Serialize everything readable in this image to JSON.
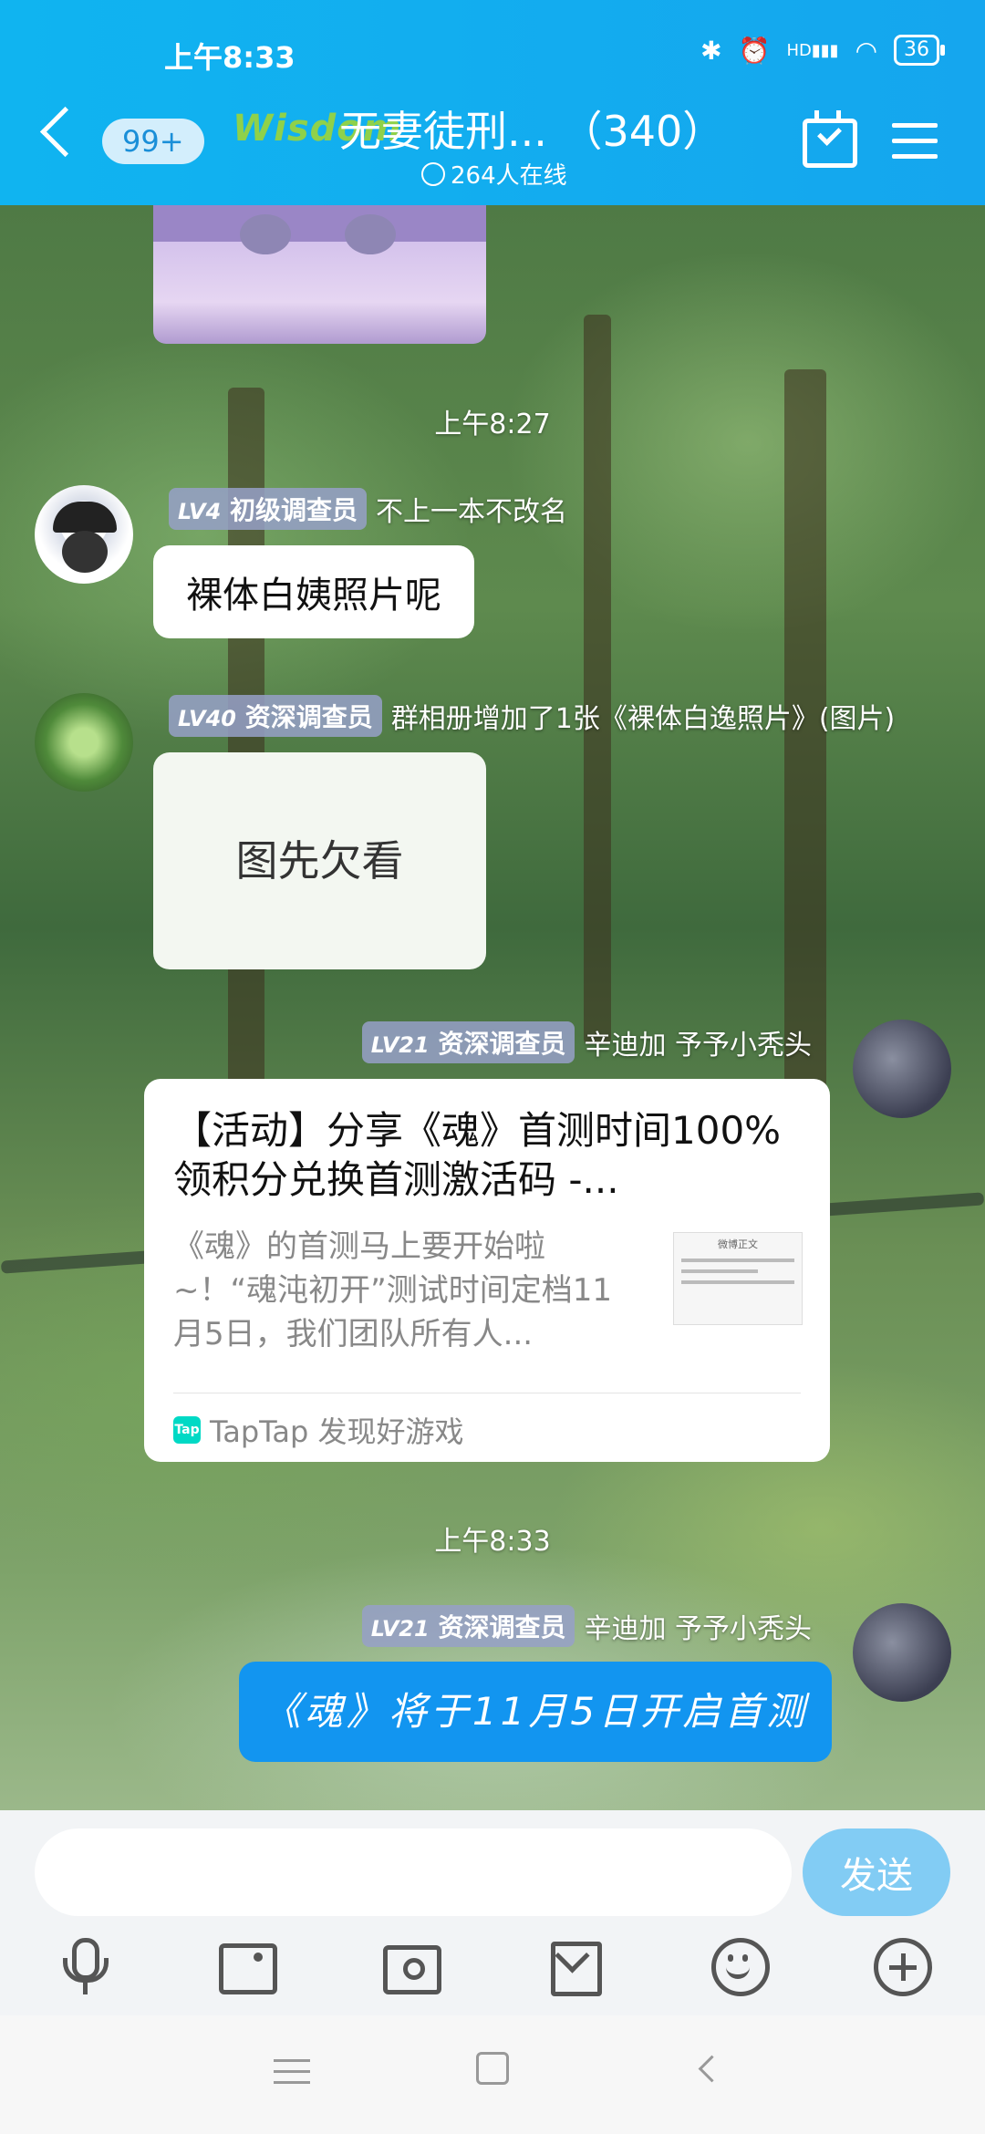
{
  "status_bar": {
    "time": "上午8:33",
    "hd_label": "HD",
    "battery": "36"
  },
  "header": {
    "unread_count": "99+",
    "group_logo": "Wisdom",
    "group_title": "无妻徒刑...  （340）",
    "online_count": "264人在线"
  },
  "messages": [
    {
      "time": "上午8:27"
    },
    {
      "level": "LV4",
      "title": "初级调查员",
      "sender": "不上一本不改名",
      "text": "裸体白姨照片呢"
    },
    {
      "level": "LV40",
      "title": "资深调查员",
      "sender": "群相册增加了1张《裸体白逸照片》(图片)",
      "placeholder_text": "图先欠看"
    },
    {
      "level": "LV21",
      "title": "资深调查员",
      "sender": "辛迪加  予予小秃头",
      "card": {
        "title": "【活动】分享《魂》首测时间100%领积分兑换首测激活码 -...",
        "description": "《魂》的首测马上要开始啦~！“魂沌初开”测试时间定档11月5日，我们团队所有人...",
        "thumb_title": "微博正文",
        "source_icon": "Tap",
        "source": "TapTap 发现好游戏"
      }
    },
    {
      "time": "上午8:33"
    },
    {
      "level": "LV21",
      "title": "资深调查员",
      "sender": "辛迪加  予予小秃头",
      "text": "《魂》将于11月5日开启首测"
    }
  ],
  "input": {
    "value": "",
    "placeholder": "",
    "send_label": "发送"
  },
  "toolbar_icons": [
    "microphone-icon",
    "image-icon",
    "camera-icon",
    "envelope-icon",
    "emoji-icon",
    "plus-icon"
  ],
  "colors": {
    "header": "#10b4f0",
    "send_button": "#82ccf4",
    "blue_bubble": "#1295f0"
  }
}
